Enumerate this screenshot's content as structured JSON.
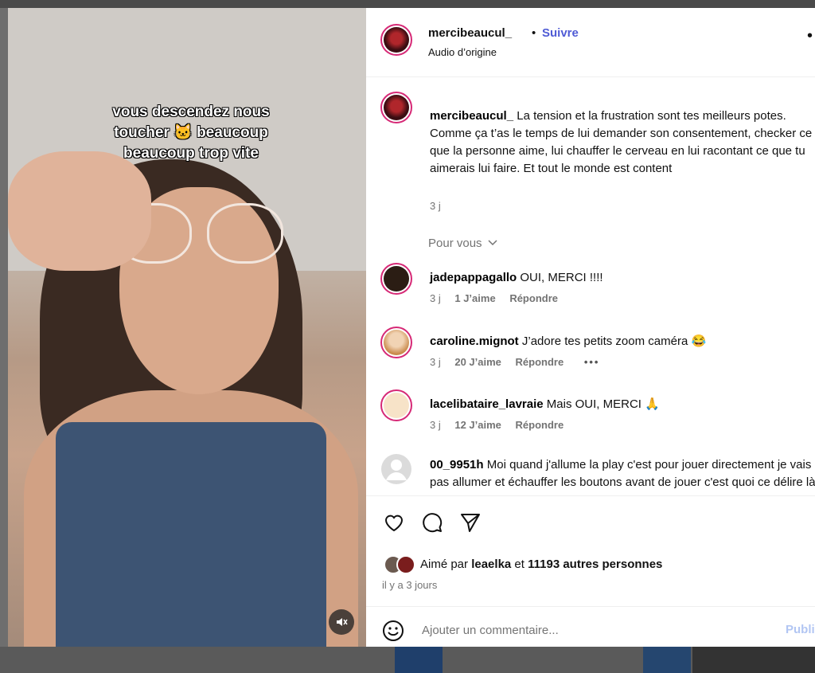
{
  "video": {
    "overlay_text_line1": "vous descendez nous",
    "overlay_text_line2": "toucher 🐱 beaucoup",
    "overlay_text_line3": "beaucoup trop vite",
    "mute_icon": "speaker-muted-icon"
  },
  "header": {
    "username": "mercibeaucul_",
    "dot": "•",
    "follow_label": "Suivre",
    "audio_label": "Audio d’origine",
    "more_icon": "more-dots-icon"
  },
  "caption": {
    "username": "mercibeaucul_",
    "text": "La tension et la frustration sont tes meilleurs potes. Comme ça t’as le temps de lui demander son consentement, checker ce que la personne aime, lui chauffer le cerveau en lui racontant ce que tu aimerais lui faire. Et tout le monde est content",
    "time": "3 j"
  },
  "pour_vous": "Pour vous",
  "comments": [
    {
      "username": "jadepappagallo",
      "text": "OUI, MERCI !!!!",
      "time": "3 j",
      "likes": "1 J’aime",
      "reply": "Répondre",
      "avatar_color": "#2b1d14"
    },
    {
      "username": "caroline.mignot",
      "text": "J’adore tes petits zoom caméra 😂",
      "time": "3 j",
      "likes": "20 J’aime",
      "reply": "Répondre",
      "more": "•••",
      "avatar_color": "#c98a4b"
    },
    {
      "username": "lacelibataire_lavraie",
      "text": "Mais OUI, MERCI 🙏",
      "time": "3 j",
      "likes": "12 J’aime",
      "reply": "Répondre",
      "avatar_color": "#f7e3c8"
    },
    {
      "username": "00_9951h",
      "text": "Moi quand j'allume la play c'est pour jouer directement je vais pas allumer et échauffer les boutons avant de jouer c'est quoi ce délire là",
      "avatar_color": "#dbdbdb"
    }
  ],
  "actions": {
    "like_icon": "heart-icon",
    "comment_icon": "comment-bubble-icon",
    "share_icon": "paper-plane-icon",
    "likes_prefix": "Aimé par",
    "likes_user": "leaelka",
    "likes_and": "et",
    "likes_count": "11193 autres personnes",
    "date": "il y a 3 jours"
  },
  "add_comment": {
    "placeholder": "Ajouter un commentaire...",
    "publish_label": "Publier",
    "emoji_icon": "smiley-icon"
  },
  "colors": {
    "link_blue": "#4f5bd5",
    "story_ring": "#d62976",
    "muted_text": "#737373"
  }
}
